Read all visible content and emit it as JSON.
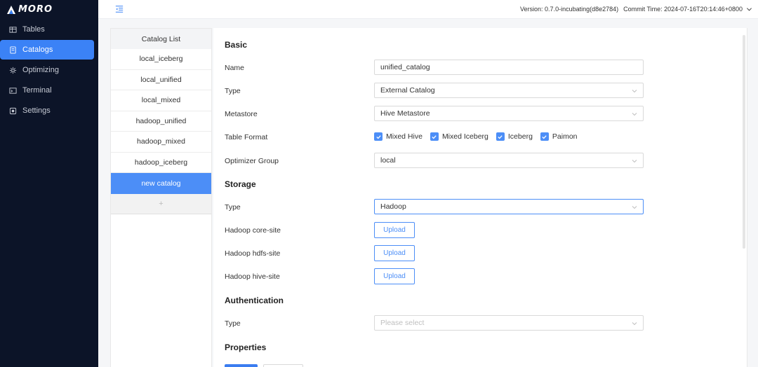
{
  "app": {
    "logo_text": "MORO"
  },
  "sidebar": {
    "items": [
      {
        "label": "Tables",
        "icon": "table-icon"
      },
      {
        "label": "Catalogs",
        "icon": "catalog-icon",
        "active": true
      },
      {
        "label": "Optimizing",
        "icon": "optimizing-icon"
      },
      {
        "label": "Terminal",
        "icon": "terminal-icon"
      },
      {
        "label": "Settings",
        "icon": "settings-icon"
      }
    ]
  },
  "header": {
    "version": "Version: 0.7.0-incubating(d8e2784)",
    "commit_time": "Commit Time: 2024-07-16T20:14:46+0800"
  },
  "catalog_list": {
    "title": "Catalog List",
    "items": [
      "local_iceberg",
      "local_unified",
      "local_mixed",
      "hadoop_unified",
      "hadoop_mixed",
      "hadoop_iceberg"
    ],
    "new_catalog": "new catalog",
    "add": "+"
  },
  "form": {
    "basic": {
      "title": "Basic",
      "name_label": "Name",
      "name_value": "unified_catalog",
      "type_label": "Type",
      "type_value": "External Catalog",
      "metastore_label": "Metastore",
      "metastore_value": "Hive Metastore",
      "table_format_label": "Table Format",
      "table_formats": [
        "Mixed Hive",
        "Mixed Iceberg",
        "Iceberg",
        "Paimon"
      ],
      "optimizer_group_label": "Optimizer Group",
      "optimizer_group_value": "local"
    },
    "storage": {
      "title": "Storage",
      "type_label": "Type",
      "type_value": "Hadoop",
      "core_site_label": "Hadoop core-site",
      "hdfs_site_label": "Hadoop hdfs-site",
      "hive_site_label": "Hadoop hive-site",
      "upload_label": "Upload"
    },
    "authentication": {
      "title": "Authentication",
      "type_label": "Type",
      "type_placeholder": "Please select"
    },
    "properties": {
      "title": "Properties"
    }
  },
  "colors": {
    "accent": "#4c8ef7",
    "sidebar_bg": "#0c1428"
  }
}
